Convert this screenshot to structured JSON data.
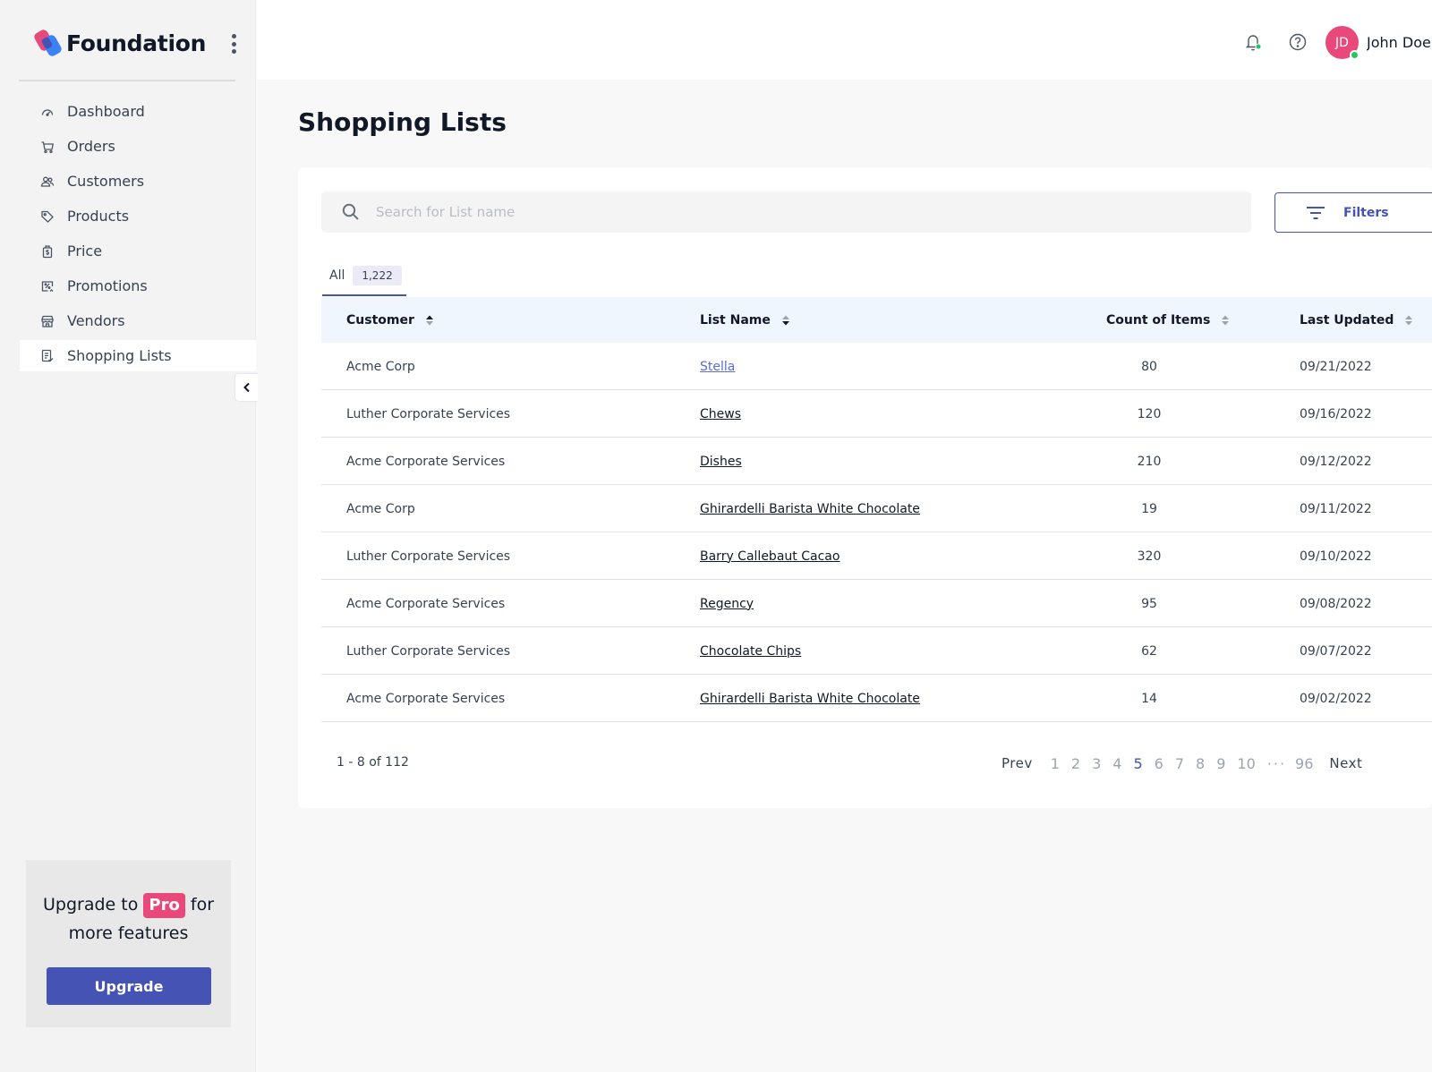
{
  "app": {
    "name": "Foundation"
  },
  "sidebar": {
    "items": [
      {
        "label": "Dashboard",
        "icon": "dashboard-icon"
      },
      {
        "label": "Orders",
        "icon": "cart-icon"
      },
      {
        "label": "Customers",
        "icon": "users-icon"
      },
      {
        "label": "Products",
        "icon": "tag-icon"
      },
      {
        "label": "Price",
        "icon": "price-icon"
      },
      {
        "label": "Promotions",
        "icon": "discount-icon"
      },
      {
        "label": "Vendors",
        "icon": "store-icon"
      },
      {
        "label": "Shopping Lists",
        "icon": "list-icon",
        "active": true
      }
    ],
    "upgrade": {
      "text_before": "Upgrade to",
      "badge": "Pro",
      "text_after": "for",
      "text_line2": "more features",
      "button_label": "Upgrade"
    }
  },
  "header": {
    "avatar_initials": "JD",
    "user_name": "John Doe"
  },
  "page": {
    "title": "Shopping Lists",
    "search_placeholder": "Search for List name",
    "filters_label": "Filters",
    "tab": {
      "label": "All",
      "count": "1,222"
    }
  },
  "table": {
    "columns": [
      "Customer",
      "List Name",
      "Count of Items",
      "Last Updated"
    ],
    "rows": [
      {
        "customer": "Acme Corp",
        "list_name": "Stella",
        "count": "80",
        "updated": "09/21/2022"
      },
      {
        "customer": "Luther Corporate Services",
        "list_name": "Chews",
        "count": "120",
        "updated": "09/16/2022"
      },
      {
        "customer": "Acme Corporate Services",
        "list_name": "Dishes",
        "count": "210",
        "updated": "09/12/2022"
      },
      {
        "customer": "Acme Corp",
        "list_name": "Ghirardelli Barista White Chocolate",
        "count": "19",
        "updated": "09/11/2022"
      },
      {
        "customer": "Luther Corporate Services",
        "list_name": "Barry Callebaut Cacao",
        "count": "320",
        "updated": "09/10/2022"
      },
      {
        "customer": "Acme Corporate Services",
        "list_name": "Regency",
        "count": "95",
        "updated": "09/08/2022"
      },
      {
        "customer": "Luther Corporate Services",
        "list_name": "Chocolate Chips",
        "count": "62",
        "updated": "09/07/2022"
      },
      {
        "customer": "Acme Corporate Services",
        "list_name": "Ghirardelli Barista White Chocolate",
        "count": "14",
        "updated": "09/02/2022"
      }
    ]
  },
  "pagination": {
    "range": "1 - 8 of 112",
    "prev": "Prev",
    "next": "Next",
    "pages": [
      "1",
      "2",
      "3",
      "4",
      "5",
      "6",
      "7",
      "8",
      "9",
      "10"
    ],
    "current": "5",
    "ellipsis": "···",
    "last": "96"
  },
  "colors": {
    "accent": "#4553b5",
    "brand_pink": "#e8497a",
    "status_online": "#22c55e"
  }
}
